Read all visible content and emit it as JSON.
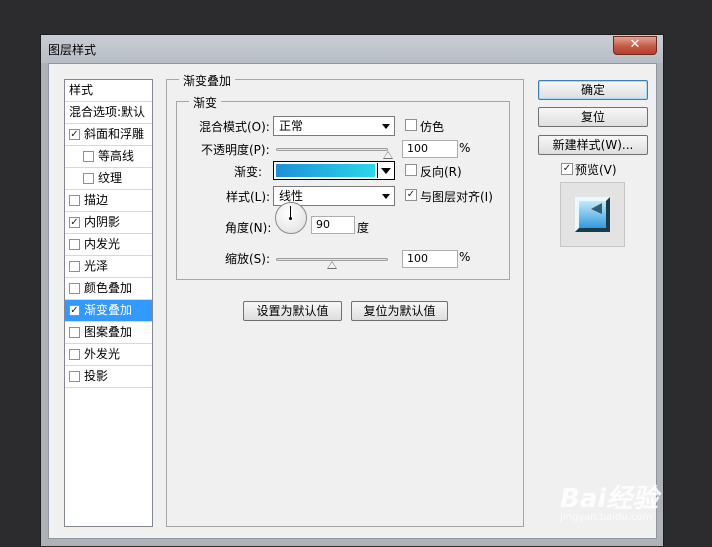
{
  "window": {
    "title": "图层样式",
    "close_glyph": "✕"
  },
  "style_list": {
    "header": "样式",
    "items": [
      {
        "label": "混合选项:默认",
        "checkbox": false,
        "checked": false,
        "indent": false,
        "selected": false
      },
      {
        "label": "斜面和浮雕",
        "checkbox": true,
        "checked": true,
        "indent": false,
        "selected": false
      },
      {
        "label": "等高线",
        "checkbox": true,
        "checked": false,
        "indent": true,
        "selected": false
      },
      {
        "label": "纹理",
        "checkbox": true,
        "checked": false,
        "indent": true,
        "selected": false
      },
      {
        "label": "描边",
        "checkbox": true,
        "checked": false,
        "indent": false,
        "selected": false
      },
      {
        "label": "内阴影",
        "checkbox": true,
        "checked": true,
        "indent": false,
        "selected": false
      },
      {
        "label": "内发光",
        "checkbox": true,
        "checked": false,
        "indent": false,
        "selected": false
      },
      {
        "label": "光泽",
        "checkbox": true,
        "checked": false,
        "indent": false,
        "selected": false
      },
      {
        "label": "颜色叠加",
        "checkbox": true,
        "checked": false,
        "indent": false,
        "selected": false
      },
      {
        "label": "渐变叠加",
        "checkbox": true,
        "checked": true,
        "indent": false,
        "selected": true
      },
      {
        "label": "图案叠加",
        "checkbox": true,
        "checked": false,
        "indent": false,
        "selected": false
      },
      {
        "label": "外发光",
        "checkbox": true,
        "checked": false,
        "indent": false,
        "selected": false
      },
      {
        "label": "投影",
        "checkbox": true,
        "checked": false,
        "indent": false,
        "selected": false
      }
    ]
  },
  "panel": {
    "section_title": "渐变叠加",
    "group_title": "渐变",
    "blend_mode_label": "混合模式(O):",
    "blend_mode_value": "正常",
    "dither_label": "仿色",
    "opacity_label": "不透明度(P):",
    "opacity_value": "100",
    "opacity_unit": "%",
    "opacity_level": 1.0,
    "gradient_label": "渐变:",
    "reverse_label": "反向(R)",
    "style_label": "样式(L):",
    "style_value": "线性",
    "align_label": "与图层对齐(I)",
    "angle_label": "角度(N):",
    "angle_value": "90",
    "angle_unit": "度",
    "scale_label": "缩放(S):",
    "scale_value": "100",
    "scale_unit": "%",
    "scale_level": 0.5,
    "set_default_button": "设置为默认值",
    "reset_default_button": "复位为默认值",
    "dither_checked": false,
    "reverse_checked": false,
    "align_checked": true
  },
  "buttons": {
    "ok": "确定",
    "reset": "复位",
    "new_style": "新建样式(W)...",
    "preview_label": "预览(V)",
    "preview_checked": true
  },
  "watermark": {
    "brand": "Bai经验",
    "url": "jingyan.baidu.com"
  },
  "colors": {
    "selection": "#3399ff",
    "gradient_start": "#1e8fd8",
    "gradient_end": "#2ad7ea"
  }
}
